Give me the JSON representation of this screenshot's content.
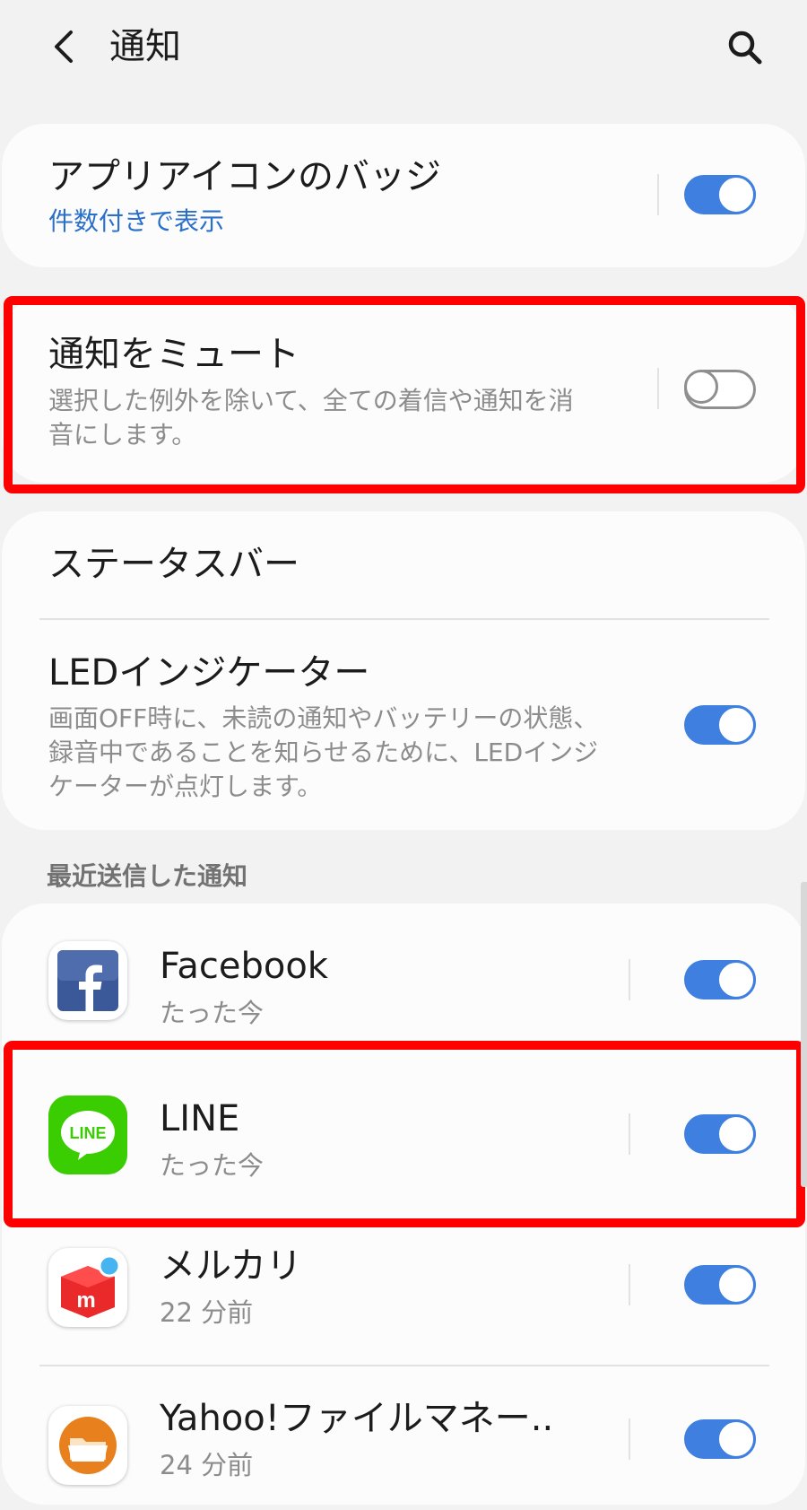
{
  "header": {
    "title": "通知",
    "back_icon": "chevron-left-icon",
    "search_icon": "search-icon"
  },
  "badge_setting": {
    "title": "アプリアイコンのバッジ",
    "subtitle": "件数付きで表示",
    "enabled": true
  },
  "mute_setting": {
    "title": "通知をミュート",
    "subtitle_line1": "選択した例外を除いて、全ての着信や通知を消",
    "subtitle_line2": "音にします。",
    "enabled": false
  },
  "status_bar": {
    "title": "ステータスバー"
  },
  "led_setting": {
    "title": "LEDインジケーター",
    "subtitle_line1": "画面OFF時に、未読の通知やバッテリーの状態、",
    "subtitle_line2": "録音中であることを知らせるために、LEDインジ",
    "subtitle_line3": "ケーターが点灯します。",
    "enabled": true
  },
  "recent": {
    "section_label": "最近送信した通知",
    "apps": [
      {
        "name": "Facebook",
        "time": "たった今",
        "icon": "facebook-icon",
        "enabled": true
      },
      {
        "name": "LINE",
        "time": "たった今",
        "icon": "line-icon",
        "icon_text": "LINE",
        "enabled": true
      },
      {
        "name": "メルカリ",
        "time": "22 分前",
        "icon": "mercari-icon",
        "icon_text": "m",
        "enabled": true
      },
      {
        "name": "Yahoo!ファイルマネー..",
        "time": "24 分前",
        "icon": "yahoo-file-manager-icon",
        "enabled": true
      }
    ]
  },
  "colors": {
    "toggle_on": "#3f7fe0",
    "highlight": "#ff0000",
    "link_blue": "#2a6fc9",
    "background": "#f2f2f2"
  }
}
